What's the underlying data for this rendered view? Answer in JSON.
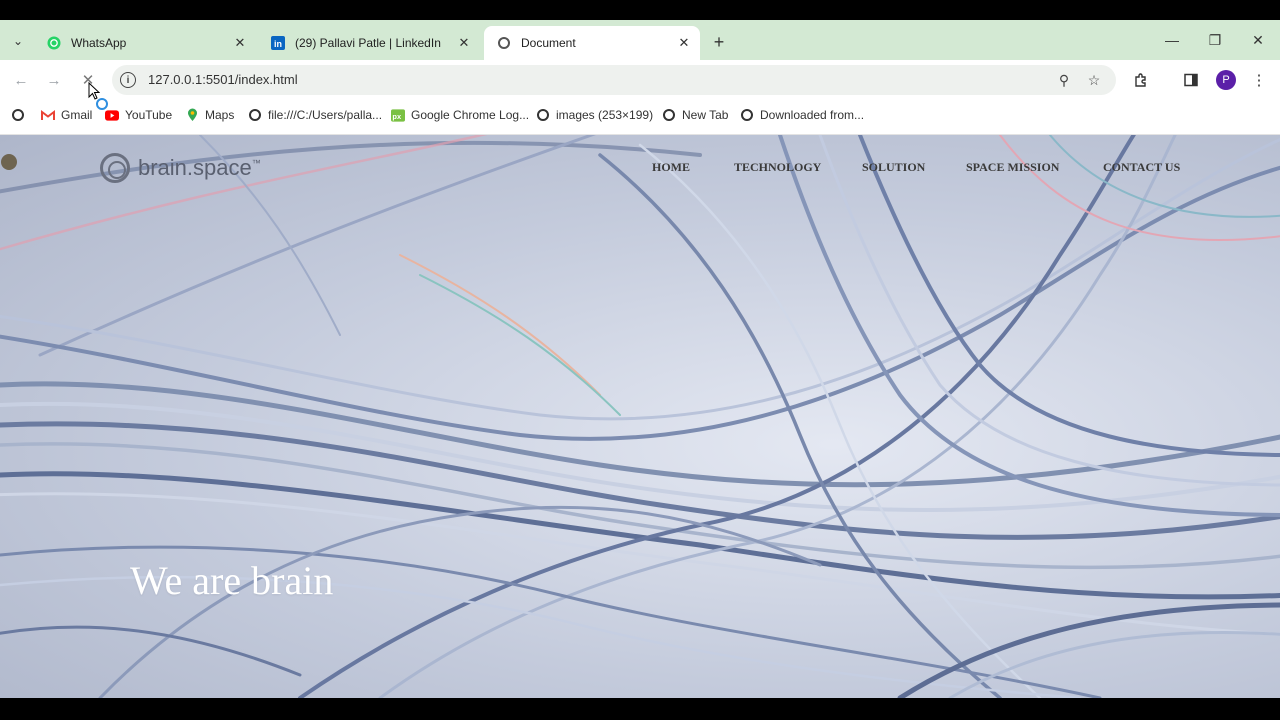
{
  "tabs": [
    {
      "title": "WhatsApp",
      "icon": "whatsapp-icon",
      "active": false
    },
    {
      "title": "(29) Pallavi Patle | LinkedIn",
      "icon": "linkedin-icon",
      "active": false
    },
    {
      "title": "Document",
      "icon": "globe-icon",
      "active": true
    }
  ],
  "toolbar": {
    "url": "127.0.0.1:5501/index.html"
  },
  "profile": {
    "initial": "P",
    "color": "#5b1fa8"
  },
  "bookmarks": [
    {
      "label": "",
      "icon": "globe-icon"
    },
    {
      "label": "Gmail",
      "icon": "gmail-icon"
    },
    {
      "label": "YouTube",
      "icon": "youtube-icon"
    },
    {
      "label": "Maps",
      "icon": "maps-icon"
    },
    {
      "label": "file:///C:/Users/palla...",
      "icon": "globe-icon"
    },
    {
      "label": "Google Chrome Log...",
      "icon": "pixlr-icon"
    },
    {
      "label": "images (253×199)",
      "icon": "globe-icon"
    },
    {
      "label": "New Tab",
      "icon": "globe-icon"
    },
    {
      "label": "Downloaded from...",
      "icon": "globe-icon"
    }
  ],
  "site": {
    "logo_text": "brain.space",
    "logo_tm": "™",
    "nav": [
      "HOME",
      "TECHNOLOGY",
      "SOLUTION",
      "SPACE MISSION",
      "CONTACT US"
    ],
    "hero": "We are brain"
  },
  "colors": {
    "tabstrip": "#d3e9d3",
    "accent_loading": "#2f8fe0"
  }
}
